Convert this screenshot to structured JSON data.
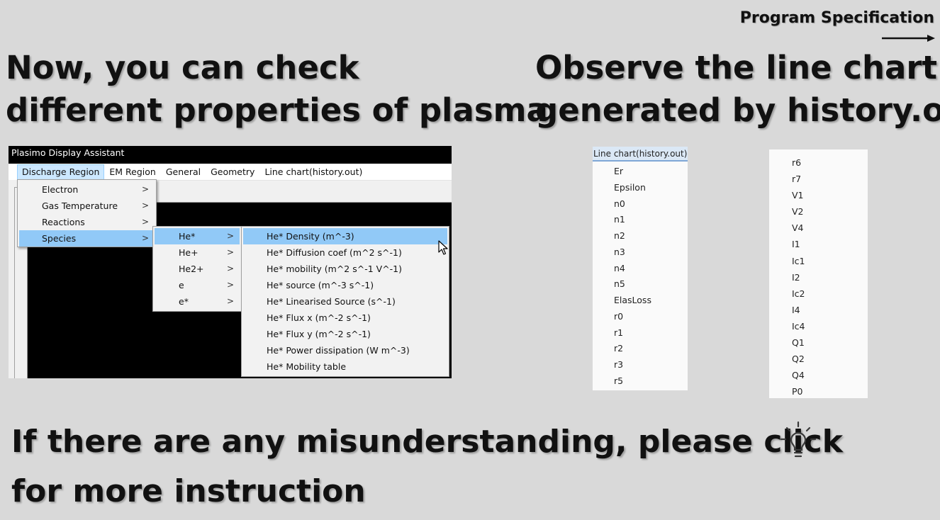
{
  "header": {
    "spec_link": "Program Specification"
  },
  "left_heading": {
    "line1": "Now, you can check",
    "line2": "different properties of plasma"
  },
  "right_heading": {
    "line1": "Observe the line chart",
    "line2": "generated by history.out"
  },
  "app": {
    "title": "Plasimo Display Assistant",
    "menubar": [
      "Discharge Region",
      "EM Region",
      "General",
      "Geometry",
      "Line chart(history.out)"
    ],
    "discharge_menu": [
      "Electron",
      "Gas Temperature",
      "Reactions",
      "Species"
    ],
    "species_menu": [
      "He*",
      "He+",
      "He2+",
      "e",
      "e*"
    ],
    "he_star_menu": [
      "He* Density (m^-3)",
      "He* Diffusion coef (m^2 s^-1)",
      "He* mobility (m^2 s^-1 V^-1)",
      "He* source (m^-3 s^-1)",
      "He* Linearised Source (s^-1)",
      "He* Flux x (m^-2 s^-1)",
      "He* Flux y (m^-2 s^-1)",
      "He* Power dissipation (W m^-3)",
      "He* Mobility table"
    ]
  },
  "history_panel": {
    "header": "Line chart(history.out)",
    "items": [
      "Er",
      "Epsilon",
      "n0",
      "n1",
      "n2",
      "n3",
      "n4",
      "n5",
      "ElasLoss",
      "r0",
      "r1",
      "r2",
      "r3",
      "r5"
    ]
  },
  "variables_panel": {
    "items": [
      "r6",
      "r7",
      "V1",
      "V2",
      "V4",
      "I1",
      "Ic1",
      "I2",
      "Ic2",
      "I4",
      "Ic4",
      "Q1",
      "Q2",
      "Q4",
      "P0"
    ]
  },
  "footer": {
    "line1": "If there are any misunderstanding, please click",
    "line2": "for more instruction"
  },
  "icons": {
    "spec_arrow": "arrow-right-icon",
    "help": "lightbulb-icon",
    "cursor": "mouse-pointer-icon",
    "submenu": "chevron-right-icon"
  },
  "colors": {
    "background": "#d9d9d9",
    "menu_highlight": "#91c9f7",
    "menubar_active": "#cce8ff",
    "panel_header": "#dbe8f6"
  }
}
